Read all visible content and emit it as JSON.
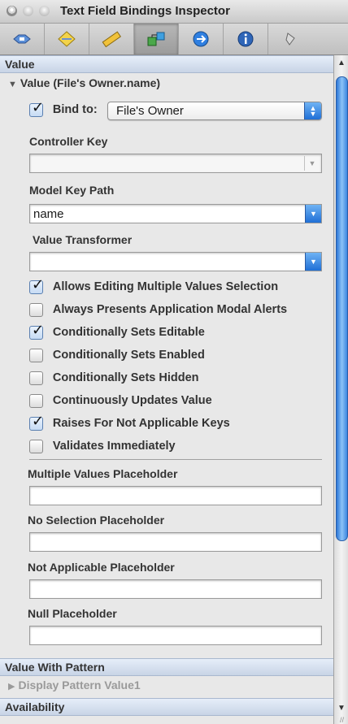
{
  "window": {
    "title": "Text Field Bindings Inspector"
  },
  "toolbar": {
    "tabs": [
      {
        "icon": "attributes-icon"
      },
      {
        "icon": "effects-icon"
      },
      {
        "icon": "size-ruler-icon"
      },
      {
        "icon": "bindings-icon",
        "active": true
      },
      {
        "icon": "connections-icon"
      },
      {
        "icon": "identity-info-icon"
      },
      {
        "icon": "applescript-icon"
      }
    ]
  },
  "value_section": {
    "header": "Value",
    "group_title": "Value (File's Owner.name)",
    "bind_to": {
      "label": "Bind to:",
      "checked": true,
      "value": "File's Owner"
    },
    "controller_key": {
      "label": "Controller Key",
      "value": ""
    },
    "model_key_path": {
      "label": "Model Key Path",
      "value": "name"
    },
    "value_transformer": {
      "label": "Value Transformer",
      "value": ""
    },
    "options": [
      {
        "label": "Allows Editing Multiple Values Selection",
        "checked": true
      },
      {
        "label": "Always Presents Application Modal Alerts",
        "checked": false
      },
      {
        "label": "Conditionally Sets Editable",
        "checked": true
      },
      {
        "label": "Conditionally Sets Enabled",
        "checked": false
      },
      {
        "label": "Conditionally Sets Hidden",
        "checked": false
      },
      {
        "label": "Continuously Updates Value",
        "checked": false
      },
      {
        "label": "Raises For Not Applicable Keys",
        "checked": true
      },
      {
        "label": "Validates Immediately",
        "checked": false
      }
    ],
    "placeholders": [
      {
        "label": "Multiple Values Placeholder",
        "value": ""
      },
      {
        "label": "No Selection Placeholder",
        "value": ""
      },
      {
        "label": "Not Applicable Placeholder",
        "value": ""
      },
      {
        "label": "Null Placeholder",
        "value": ""
      }
    ]
  },
  "value_with_pattern_section": {
    "header": "Value With Pattern",
    "group_title": "Display Pattern Value1"
  },
  "availability_section": {
    "header": "Availability"
  }
}
